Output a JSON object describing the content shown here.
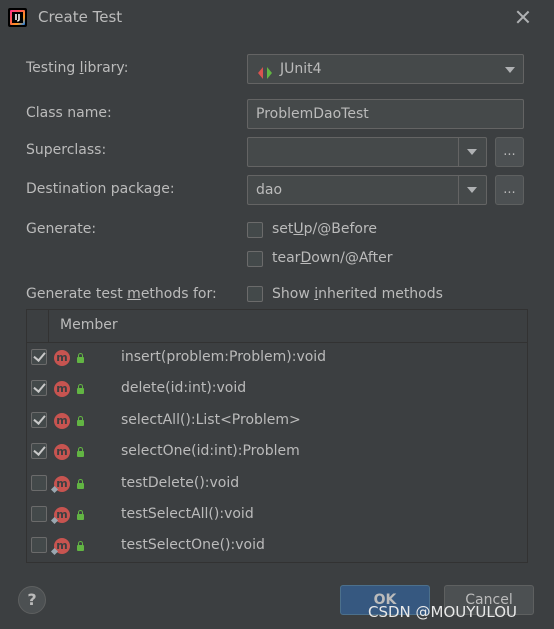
{
  "window": {
    "title": "Create Test"
  },
  "form": {
    "testing_library": {
      "label_pre": "Testing ",
      "label_mn": "l",
      "label_post": "ibrary:",
      "value": "JUnit4"
    },
    "class_name": {
      "label": "Class name:",
      "value": "ProblemDaoTest"
    },
    "superclass": {
      "label": "Superclass:",
      "value": ""
    },
    "destination_package": {
      "label": "Destination package:",
      "value": "dao"
    },
    "browse_label": "...",
    "generate": {
      "label": "Generate:",
      "setup": {
        "pre": "set",
        "mn": "U",
        "post": "p/@Before",
        "checked": false
      },
      "teardown": {
        "pre": "tear",
        "mn": "D",
        "post": "own/@After",
        "checked": false
      }
    },
    "methods_for": {
      "pre": "Generate test ",
      "mn": "m",
      "post": "ethods for:"
    },
    "show_inherited": {
      "pre": "Show ",
      "mn": "i",
      "post": "nherited methods",
      "checked": false
    }
  },
  "table": {
    "header": "Member",
    "rows": [
      {
        "name": "insert(problem:Problem):void",
        "checked": true,
        "icon": "method-icon"
      },
      {
        "name": "delete(id:int):void",
        "checked": true,
        "icon": "method-icon"
      },
      {
        "name": "selectAll():List<Problem>",
        "checked": true,
        "icon": "method-icon"
      },
      {
        "name": "selectOne(id:int):Problem",
        "checked": true,
        "icon": "method-icon"
      },
      {
        "name": "testDelete():void",
        "checked": false,
        "icon": "method-icon"
      },
      {
        "name": "testSelectAll():void",
        "checked": false,
        "icon": "method-icon"
      },
      {
        "name": "testSelectOne():void",
        "checked": false,
        "icon": "method-icon"
      }
    ]
  },
  "footer": {
    "help_label": "?",
    "ok_label": "OK",
    "cancel_label": "Cancel"
  },
  "watermark": "CSDN @MOUYULOU"
}
